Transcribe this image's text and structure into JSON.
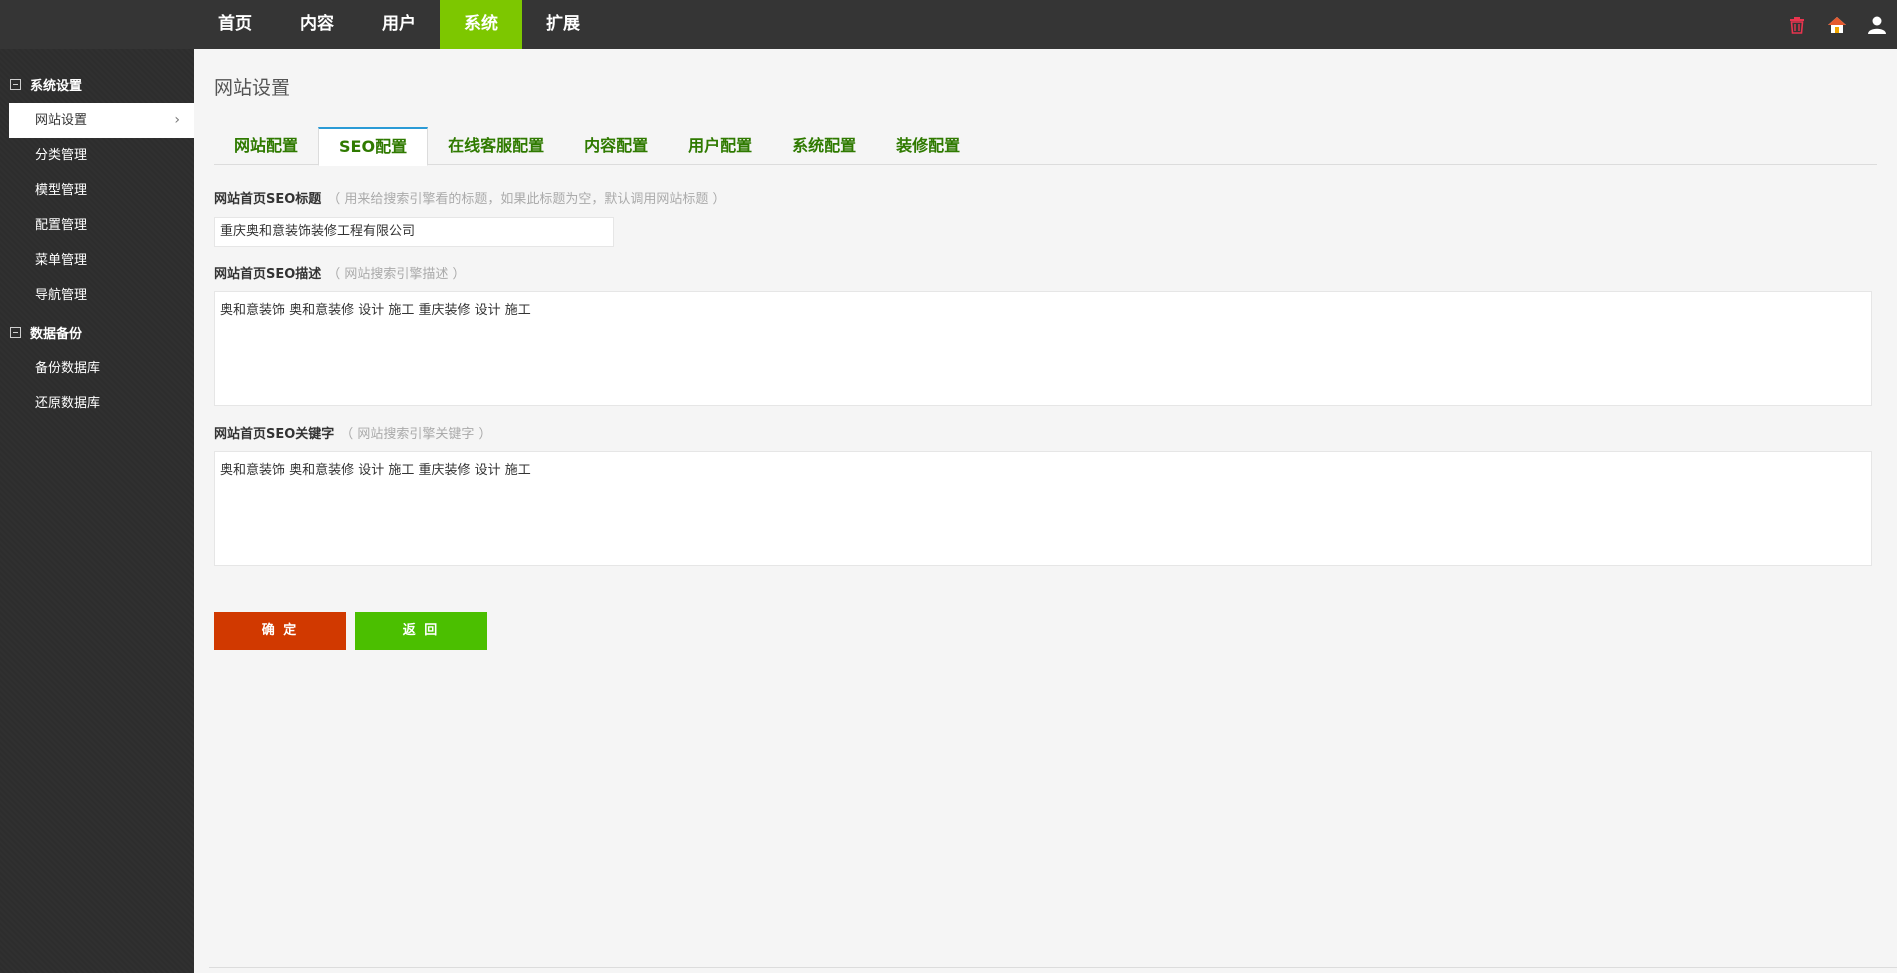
{
  "topnav": {
    "items": [
      {
        "label": "首页"
      },
      {
        "label": "内容"
      },
      {
        "label": "用户"
      },
      {
        "label": "系统",
        "active": true
      },
      {
        "label": "扩展"
      }
    ],
    "icons": [
      "trash-icon",
      "home-icon",
      "user-icon"
    ]
  },
  "sidebar": {
    "groups": [
      {
        "title": "系统设置",
        "items": [
          "网站设置",
          "分类管理",
          "模型管理",
          "配置管理",
          "菜单管理",
          "导航管理"
        ]
      },
      {
        "title": "数据备份",
        "items": [
          "备份数据库",
          "还原数据库"
        ]
      }
    ],
    "active_chevron": "›"
  },
  "main": {
    "title": "网站设置",
    "tabs": [
      "网站配置",
      "SEO配置",
      "在线客服配置",
      "内容配置",
      "用户配置",
      "系统配置",
      "装修配置"
    ],
    "active_tab": "SEO配置",
    "fields": {
      "seo_title": {
        "label": "网站首页SEO标题",
        "hint": "（ 用来给搜索引擎看的标题，如果此标题为空，默认调用网站标题 ）",
        "value": "重庆奥和意装饰装修工程有限公司"
      },
      "seo_desc": {
        "label": "网站首页SEO描述",
        "hint": "（ 网站搜索引擎描述 ）",
        "value": "奥和意装饰 奥和意装修 设计 施工 重庆装修 设计 施工"
      },
      "seo_keywords": {
        "label": "网站首页SEO关键字",
        "hint": "（ 网站搜索引擎关键字 ）",
        "value": "奥和意装饰 奥和意装修 设计 施工 重庆装修 设计 施工"
      }
    },
    "buttons": {
      "confirm": "确 定",
      "back": "返 回"
    }
  },
  "colors": {
    "topbar": "#353535",
    "active_nav": "#7dc700",
    "sidebar": "#2d2d2d",
    "tab_text": "#2f7a00",
    "tab_active_border": "#2b9bd6",
    "confirm_button": "#d13900",
    "back_button": "#4bbf00"
  }
}
